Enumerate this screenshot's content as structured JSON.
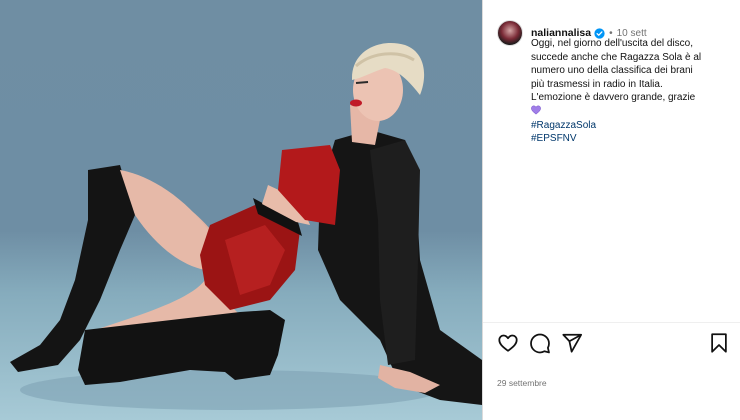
{
  "post": {
    "username": "naliannalisa",
    "time_ago": "10 sett",
    "caption_lines": [
      "Oggi, nel giorno dell'uscita del disco,",
      "succede anche che Ragazza Sola è al",
      "numero uno della classifica dei brani",
      "più trasmessi in radio in Italia.",
      "L'emozione è davvero grande, grazie"
    ],
    "hashtags": [
      "#RagazzaSola",
      "#EPSFNV"
    ],
    "date": "29 settembre"
  },
  "colors": {
    "verified": "#0095f6",
    "hashtag": "#00376b",
    "purple_heart": "#a07ee8"
  },
  "icons": {
    "like": "heart-icon",
    "comment": "comment-icon",
    "share": "share-icon",
    "save": "bookmark-icon",
    "verified": "verified-badge-icon"
  }
}
